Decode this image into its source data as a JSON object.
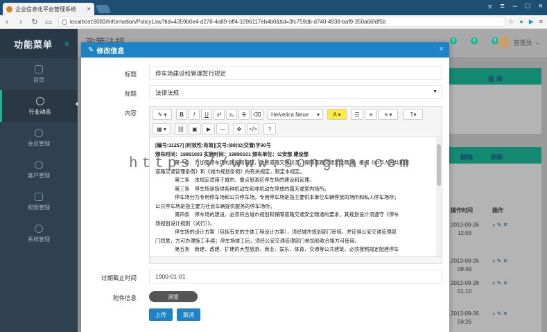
{
  "browser": {
    "tab_title": "企业信息化平台管理系统",
    "url": "localhost:8083/Information/PolicyLaw?tid=4359b0e4-d278-4a89-bff4-1096117eb4b0&tid=3fc759db-d740-4938-baf9-350a66fdf5b"
  },
  "sidebar": {
    "title": "功能菜单",
    "items": [
      {
        "label": "首页"
      },
      {
        "label": "行业动态"
      },
      {
        "label": "会员管理"
      },
      {
        "label": "客户管理"
      },
      {
        "label": "权限管理"
      },
      {
        "label": "系统管理"
      }
    ]
  },
  "header": {
    "page_title": "政策法规",
    "badges": [
      "9",
      "8",
      "8"
    ],
    "user": "管理员"
  },
  "background": {
    "query": "查 询",
    "delete": "删除",
    "refresh": "刷新",
    "col_time": "操作时间",
    "col_action": "操作",
    "dates": [
      "2013-09-26",
      "2013-09-26",
      "2013-09-26",
      "2013-09-26"
    ],
    "times": [
      "12:03",
      "09:49",
      "01:10",
      "59:26"
    ]
  },
  "modal": {
    "title": "修改信息",
    "title_label": "标题",
    "title_value": "停车场建设和管理暂行规定",
    "category_label": "标题",
    "category_value": "法律法规",
    "content_label": "内容",
    "font_name": "Helvetica Neue",
    "toolbar": {
      "bold": "B",
      "italic": "I",
      "underline": "U",
      "sup": "x²",
      "sub": "x₂",
      "strike": "S",
      "text_size": "T"
    },
    "content_lines": [
      "[编号:11257] [时效性:有效][文号:(88)公(交管)字90号",
      "颁布时间：19881003 实施时间：19890101 颁布单位：公安部 建设部",
      "",
      "第一条　为加强停车场的建设和管理，改善道路交通状况，保障道路交通安全畅通，根据《中华人民共和国",
      "道路交通管理条例》和《城市规划条例》的有关规定，制定本规定。",
      "第二条　本规定适用于城市、重点旅游区停车场的建设和管理。",
      "第三条　停车场是指供各种机动车和非机动车停放的露天或室内场所。",
      "停车场分为专用停车场和公共停车场。专用停车场是指主要供本单位车辆停放的场所和私人停车场所；",
      "公共停车场是指主要为社会车辆提供服务的停车场所。",
      "第四条　停车场的建设，必须符合城市规划和保障道路交通安全畅通的要求，其规划设计须遵守《停车",
      "场规划设计规则（试行）》。",
      "停车场的设计方案（包括有关的主体工程设计方案），须经城市规划部门审核，并征得公安交通管理部",
      "门同意，方可办理施工手续；停车场竣工后，须经公安交通管理部门参加验收合格方可使用。",
      "第五条　新建、改建、扩建的大型旅游、商业、娱乐、体育、交通等公共建筑，必须按照规定配建停车"
    ],
    "expire_label": "过期截止时间",
    "expire_value": "1900-01-01",
    "attach_label": "附件信息",
    "browse_label": "浏览",
    "upload_label": "上传",
    "cancel_label": "取消"
  },
  "watermark": "https://www.songma.com"
}
